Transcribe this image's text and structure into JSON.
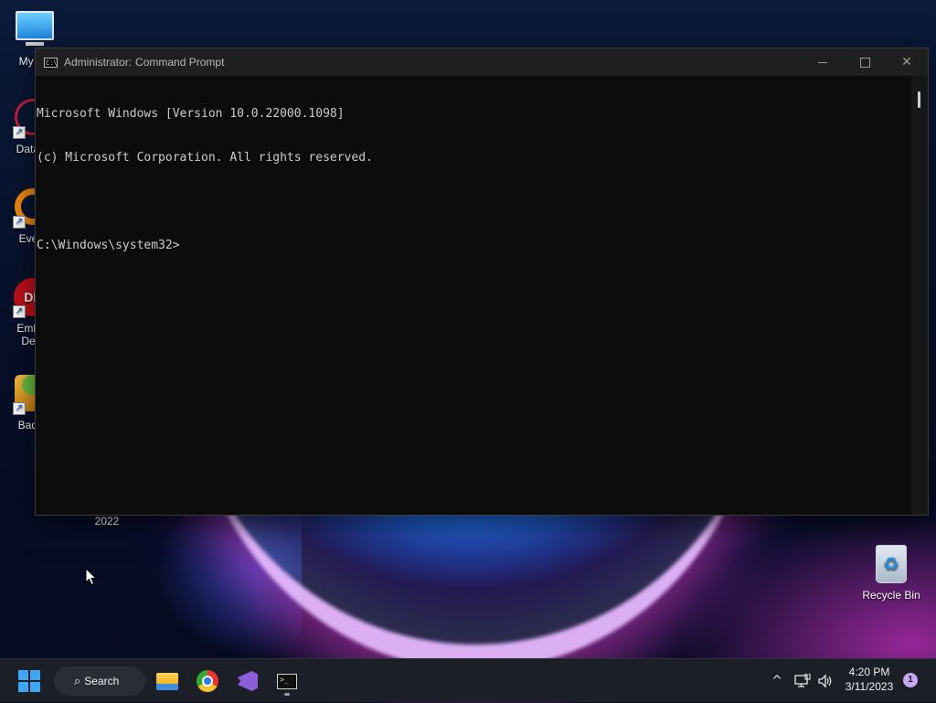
{
  "desktop": {
    "icons": [
      {
        "label": "My Co",
        "icon": "this-pc-icon"
      },
      {
        "label": "DataW",
        "icon": "datawarrior-icon"
      },
      {
        "label": "Every",
        "icon": "everything-search-icon"
      },
      {
        "label": "Embar",
        "label2": "Dev-",
        "icon": "embarcadero-devcpp-icon"
      },
      {
        "label": "Bad P",
        "icon": "bad-piggies-icon"
      }
    ],
    "stray_label": "2022",
    "recycle_bin": {
      "label": "Recycle Bin",
      "icon": "recycle-bin-icon"
    }
  },
  "window": {
    "title_prefix": "Administrator:",
    "title_app": "Command Prompt",
    "app_icon_glyph": "C:\\",
    "controls": {
      "minimize": "minimize-icon",
      "maximize": "maximize-icon",
      "close": "close-icon",
      "close_glyph": "✕"
    },
    "console_lines": [
      "Microsoft Windows [Version 10.0.22000.1098]",
      "(c) Microsoft Corporation. All rights reserved.",
      "",
      "C:\\Windows\\system32>"
    ]
  },
  "taskbar": {
    "start_icon": "windows-start-icon",
    "search_label": "Search",
    "search_glyph": "⌕",
    "pinned": [
      {
        "name": "File Explorer",
        "icon": "file-explorer-icon"
      },
      {
        "name": "Google Chrome",
        "icon": "chrome-icon"
      },
      {
        "name": "Visual Studio",
        "icon": "visual-studio-icon"
      },
      {
        "name": "Command Prompt",
        "icon": "terminal-icon",
        "running": true,
        "glyph": ">_"
      }
    ],
    "tray": {
      "overflow_glyph": "^",
      "network_icon": "network-icon",
      "volume_icon": "volume-icon",
      "time": "4:20 PM",
      "date": "3/11/2023",
      "notification_count": "1"
    }
  },
  "colors": {
    "console_bg": "#0c0c0c",
    "console_text": "#cccccc",
    "titlebar_bg": "#1f1f1f",
    "taskbar_bg": "#1c1f28",
    "accent": "#3ea6f5"
  }
}
